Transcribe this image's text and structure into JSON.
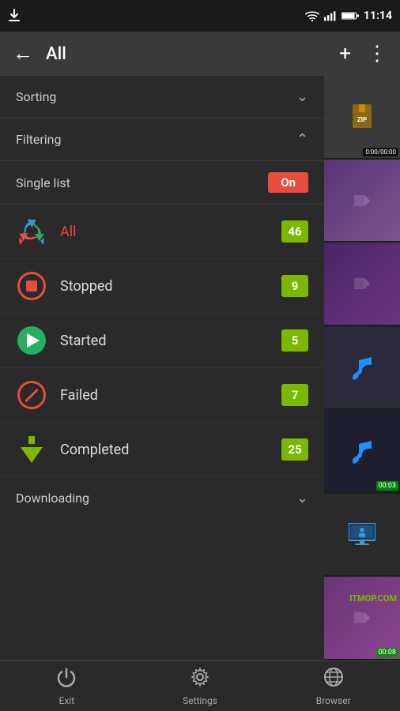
{
  "statusBar": {
    "time": "11:14",
    "icons": [
      "download-icon",
      "wifi-icon",
      "signal-icon",
      "battery-icon"
    ]
  },
  "toolbar": {
    "backLabel": "←",
    "title": "All",
    "addLabel": "+",
    "menuLabel": "⋮"
  },
  "sorting": {
    "label": "Sorting",
    "expanded": false
  },
  "filtering": {
    "label": "Filtering",
    "expanded": true
  },
  "singleList": {
    "label": "Single list",
    "value": "On"
  },
  "filterItems": [
    {
      "id": "all",
      "label": "All",
      "count": 46,
      "iconType": "recycle"
    },
    {
      "id": "stopped",
      "label": "Stopped",
      "count": 9,
      "iconType": "stop"
    },
    {
      "id": "started",
      "label": "Started",
      "count": 5,
      "iconType": "play"
    },
    {
      "id": "failed",
      "label": "Failed",
      "count": 7,
      "iconType": "failed"
    },
    {
      "id": "completed",
      "label": "Completed",
      "count": 25,
      "iconType": "completed"
    }
  ],
  "downloading": {
    "label": "Downloading"
  },
  "bottomNav": [
    {
      "id": "exit",
      "label": "Exit",
      "icon": "power-icon"
    },
    {
      "id": "settings",
      "label": "Settings",
      "icon": "gear-icon"
    },
    {
      "id": "browser",
      "label": "Browser",
      "icon": "globe-icon"
    }
  ],
  "thumbnails": [
    {
      "type": "zip",
      "timeLabel": "0:00/00:00"
    },
    {
      "type": "video"
    },
    {
      "type": "video"
    },
    {
      "type": "music"
    },
    {
      "type": "music",
      "timeLabel": "00:03"
    },
    {
      "type": "monitor"
    },
    {
      "type": "video",
      "timeLabel": "00:08"
    }
  ],
  "watermark": "ITMOP.COM"
}
